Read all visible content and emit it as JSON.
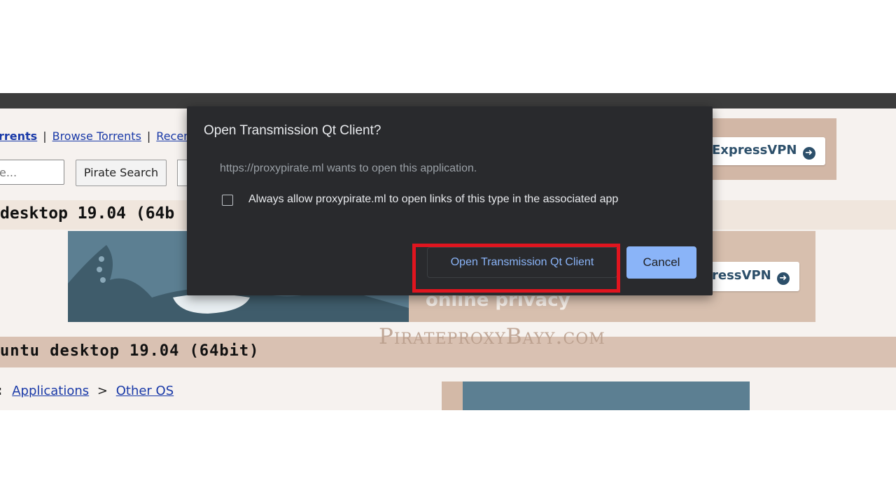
{
  "page": {
    "nav": {
      "torrents_link": "rrents",
      "separator": "|",
      "browse_link": "Browse Torrents",
      "recent_link": "Recen"
    },
    "search": {
      "value": "e...",
      "button_label": "Pirate Search"
    },
    "title_top": "desktop 19.04 (64b",
    "ad_top": {
      "button_label": "ExpressVPN",
      "arrow_icon": "arrow-right-circle-icon"
    },
    "ad_mid": {
      "button_label": "ressVPN",
      "tagline": "online privacy"
    },
    "title_main": "untu desktop 19.04 (64bit)",
    "breadcrumb": {
      "colon": ":",
      "category": "Applications",
      "separator": ">",
      "subcategory": "Other OS"
    }
  },
  "dialog": {
    "title": "Open Transmission Qt Client?",
    "message": "https://proxypirate.ml wants to open this application.",
    "checkbox_label": "Always allow proxypirate.ml to open links of this type in the associated app",
    "checkbox_checked": false,
    "open_button_label": "Open Transmission Qt Client",
    "cancel_button_label": "Cancel"
  },
  "watermark": "PirateproxyBayy.com",
  "colors": {
    "dialog_bg": "#292a2d",
    "accent_blue": "#8ab4f8",
    "highlight_red": "#e0151f",
    "link_blue": "#1a3aa8"
  }
}
